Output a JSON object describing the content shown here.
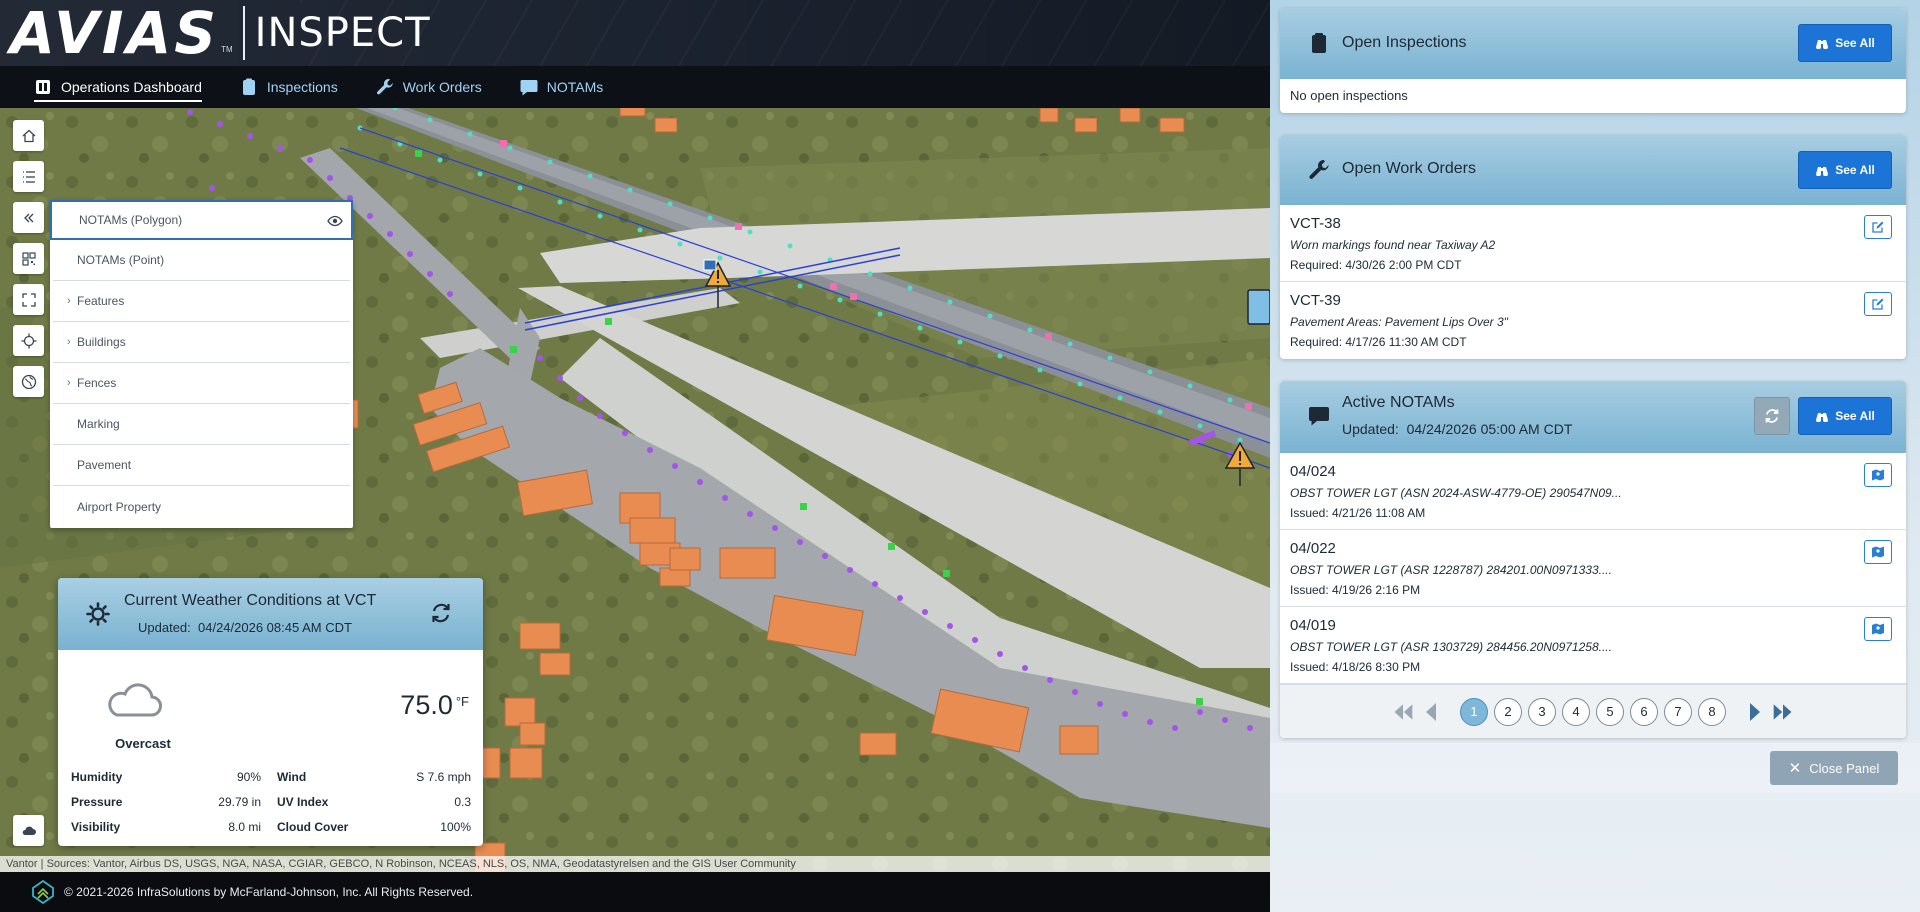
{
  "header": {
    "logo_text": "AVIAS",
    "logo_tm": "TM",
    "product": "INSPECT"
  },
  "nav": [
    {
      "label": "Operations Dashboard",
      "icon": "dashboard-icon",
      "active": true
    },
    {
      "label": "Inspections",
      "icon": "clipboard-icon",
      "active": false
    },
    {
      "label": "Work Orders",
      "icon": "wrench-icon",
      "active": false
    },
    {
      "label": "NOTAMs",
      "icon": "chat-icon",
      "active": false
    }
  ],
  "map_tools": [
    "home-icon",
    "list-icon",
    "collapse-icon",
    "qr-icon",
    "fullscreen-icon",
    "locate-icon",
    "basemap-icon"
  ],
  "layers": [
    {
      "label": "NOTAMs (Polygon)",
      "expandable": false,
      "selected": true
    },
    {
      "label": "NOTAMs (Point)",
      "expandable": false,
      "selected": false
    },
    {
      "label": "Features",
      "expandable": true,
      "selected": false
    },
    {
      "label": "Buildings",
      "expandable": true,
      "selected": false
    },
    {
      "label": "Fences",
      "expandable": true,
      "selected": false
    },
    {
      "label": "Marking",
      "expandable": false,
      "selected": false
    },
    {
      "label": "Pavement",
      "expandable": false,
      "selected": false
    },
    {
      "label": "Airport Property",
      "expandable": false,
      "selected": false
    }
  ],
  "weather": {
    "title": "Current Weather Conditions at VCT",
    "updated_label": "Updated:",
    "updated_value": "04/24/2026 08:45 AM CDT",
    "condition": "Overcast",
    "temperature": "75.0",
    "temp_unit": "°F",
    "rows": [
      {
        "label": "Humidity",
        "value": "90%",
        "label2": "Wind",
        "value2": "S 7.6 mph"
      },
      {
        "label": "Pressure",
        "value": "29.79 in",
        "label2": "UV Index",
        "value2": "0.3"
      },
      {
        "label": "Visibility",
        "value": "8.0 mi",
        "label2": "Cloud Cover",
        "value2": "100%"
      }
    ]
  },
  "attribution": "Vantor | Sources: Vantor, Airbus DS, USGS, NGA, NASA, CGIAR, GEBCO, N Robinson, NCEAS, NLS, OS, NMA, Geodatastyrelsen and the GIS User Community",
  "footer": {
    "copyright": "© 2021-2026 InfraSolutions by McFarland-Johnson, Inc. All Rights Reserved."
  },
  "panel": {
    "inspections": {
      "title": "Open Inspections",
      "see_all": "See All",
      "empty": "No open inspections"
    },
    "work_orders": {
      "title": "Open Work Orders",
      "see_all": "See All",
      "items": [
        {
          "id": "VCT-38",
          "desc": "Worn markings found near Taxiway A2",
          "meta": "Required: 4/30/26 2:00 PM CDT"
        },
        {
          "id": "VCT-39",
          "desc": "Pavement Areas: Pavement Lips Over 3\"",
          "meta": "Required: 4/17/26 11:30 AM CDT"
        }
      ]
    },
    "notams": {
      "title": "Active NOTAMs",
      "updated_label": "Updated:",
      "updated_value": "04/24/2026 05:00 AM CDT",
      "see_all": "See All",
      "items": [
        {
          "id": "04/024",
          "desc": "OBST TOWER LGT (ASN 2024-ASW-4779-OE) 290547N09...",
          "meta": "Issued: 4/21/26 11:08 AM"
        },
        {
          "id": "04/022",
          "desc": "OBST TOWER LGT (ASR 1228787) 284201.00N0971333....",
          "meta": "Issued: 4/19/26 2:16 PM"
        },
        {
          "id": "04/019",
          "desc": "OBST TOWER LGT (ASR 1303729) 284456.20N0971258....",
          "meta": "Issued: 4/18/26 8:30 PM"
        }
      ],
      "pages": [
        "1",
        "2",
        "3",
        "4",
        "5",
        "6",
        "7",
        "8"
      ],
      "current_page": "1"
    },
    "close_label": "Close Panel"
  },
  "colors": {
    "accent_blue": "#1b74d6",
    "card_header": "#7ab3d2",
    "nav_link": "#9fd2f3",
    "building_orange": "#e8894f"
  }
}
